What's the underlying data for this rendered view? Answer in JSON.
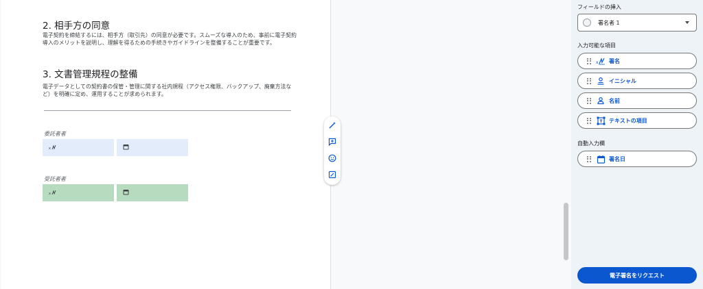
{
  "document": {
    "section2": {
      "heading": "2. 相手方の同意",
      "body": "電子契約を締結するには、相手方（取引先）の同意が必要です。スムーズな導入のため、事前に電子契約導入のメリットを説明し、理解を得るための手続きやガイドラインを整備することが重要です。"
    },
    "section3": {
      "heading": "3. 文書管理規程の整備",
      "body": "電子データとしての契約書の保管・管理に関する社内規程（アクセス権限、バックアップ、廃棄方法など）を明確に定め、運用することが求められます。"
    },
    "party1": {
      "label": "委託者者"
    },
    "party2": {
      "label": "受託者者"
    }
  },
  "panel": {
    "insert_fields_title": "フィールドの挿入",
    "signer": {
      "name": "署名者 1"
    },
    "available_title": "入力可能な項目",
    "items": [
      {
        "label": "署名",
        "icon": "signature-icon"
      },
      {
        "label": "イニシャル",
        "icon": "initials-icon"
      },
      {
        "label": "名前",
        "icon": "person-icon"
      },
      {
        "label": "テキストの項目",
        "icon": "text-field-icon"
      }
    ],
    "auto_title": "自動入力欄",
    "auto_items": [
      {
        "label": "署名日",
        "icon": "calendar-icon"
      }
    ],
    "request_button": "電子署名をリクエスト"
  },
  "colors": {
    "accent": "#0b57d0",
    "field_blue": "#e3ecfb",
    "field_green": "#b7dbbf",
    "panel_bg": "#eef3f8"
  }
}
